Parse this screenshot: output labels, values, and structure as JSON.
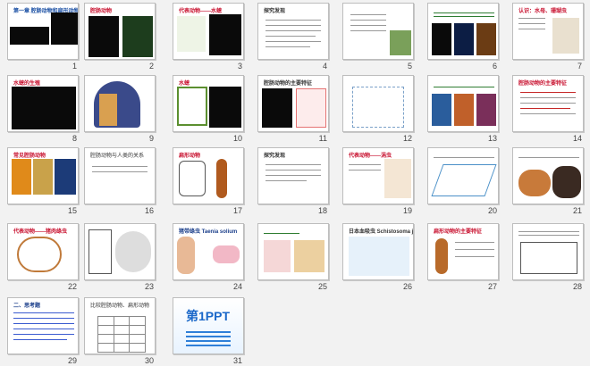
{
  "slides": [
    {
      "num": "1",
      "header": "第一章  腔肠动物和扁形动物"
    },
    {
      "num": "2",
      "header": "腔肠动物"
    },
    {
      "num": "3",
      "header": "代表动物——水螅"
    },
    {
      "num": "4",
      "header": "探究发现"
    },
    {
      "num": "5",
      "header": ""
    },
    {
      "num": "6",
      "header": ""
    },
    {
      "num": "7",
      "header": "认识：水母、珊瑚虫"
    },
    {
      "num": "8",
      "header": "水螅的生殖"
    },
    {
      "num": "9",
      "header": ""
    },
    {
      "num": "10",
      "header": "水螅"
    },
    {
      "num": "11",
      "header": "腔肠动物的主要特征"
    },
    {
      "num": "12",
      "header": ""
    },
    {
      "num": "13",
      "header": ""
    },
    {
      "num": "14",
      "header": "腔肠动物的主要特征"
    },
    {
      "num": "15",
      "header": "常见腔肠动物"
    },
    {
      "num": "16",
      "header": "腔肠动物与人类的关系"
    },
    {
      "num": "17",
      "header": "扁形动物"
    },
    {
      "num": "18",
      "header": "探究发现"
    },
    {
      "num": "19",
      "header": "代表动物——涡虫"
    },
    {
      "num": "20",
      "header": ""
    },
    {
      "num": "21",
      "header": ""
    },
    {
      "num": "22",
      "header": "代表动物——猪肉绦虫"
    },
    {
      "num": "23",
      "header": ""
    },
    {
      "num": "24",
      "header": "猪带绦虫  Taenia solium"
    },
    {
      "num": "25",
      "header": ""
    },
    {
      "num": "26",
      "header": "日本血吸虫  Schistosoma japonicum"
    },
    {
      "num": "27",
      "header": "扁形动物的主要特征"
    },
    {
      "num": "28",
      "header": ""
    },
    {
      "num": "29",
      "header": "二、思考题"
    },
    {
      "num": "30",
      "header": "比较腔肠动物、扁形动物"
    },
    {
      "num": "31",
      "header": "第1PPT"
    }
  ]
}
